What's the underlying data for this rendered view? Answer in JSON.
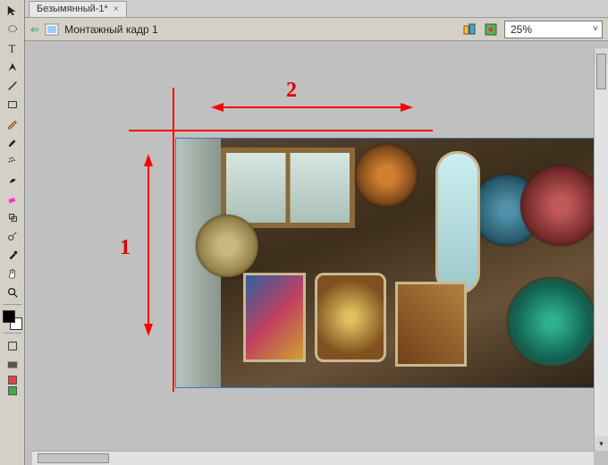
{
  "tab": {
    "title": "Безымянный-1*",
    "close_glyph": "×"
  },
  "breadcrumb": {
    "arrow_glyph": "⇐",
    "label": "Монтажный кадр 1"
  },
  "zoom": {
    "value": "25%",
    "chevron": "˅"
  },
  "annotations": {
    "label1": "1",
    "label2": "2"
  },
  "tools": {
    "move": "move-tool",
    "lasso": "lasso-tool",
    "type": "type-tool",
    "pen": "pen-tool",
    "line": "line-tool",
    "rect": "rectangle-tool",
    "pencil": "pencil-tool",
    "brush": "brush-tool",
    "spray": "spray-tool",
    "smudge": "smudge-tool",
    "eraser": "eraser-tool",
    "clone": "clone-tool",
    "dodge": "dodge-tool",
    "eyedrop": "eyedropper-tool",
    "hand": "hand-tool",
    "zoom": "zoom-tool"
  },
  "scroll": {
    "up": "▴",
    "down": "▾"
  }
}
